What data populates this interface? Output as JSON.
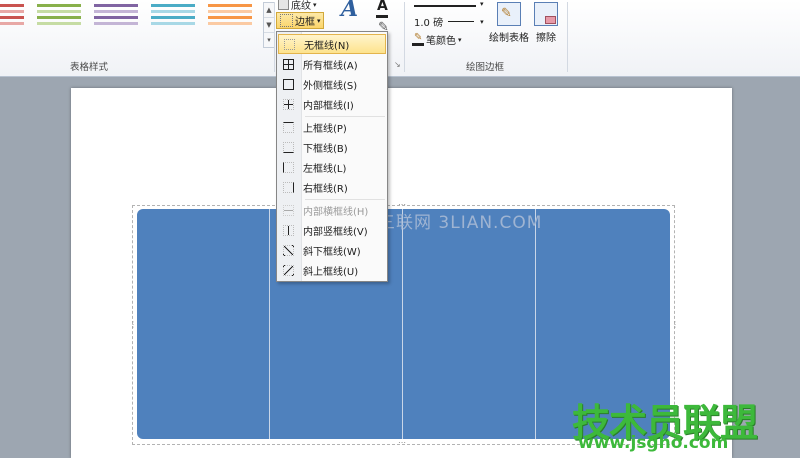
{
  "ribbon": {
    "groups": {
      "table_styles": "表格样式",
      "draw_borders": "绘图边框"
    },
    "shading_label": "底纹",
    "borders_label": "边框",
    "line_weight": "1.0 磅",
    "pen_color_label": "笔颜色",
    "draw_table_label": "绘制表格",
    "eraser_label": "擦除"
  },
  "border_menu": {
    "items": [
      {
        "label": "无框线(N)",
        "icon": "no-border-icon",
        "highlighted": true,
        "disabled": false
      },
      {
        "label": "所有框线(A)",
        "icon": "all-borders-icon",
        "highlighted": false,
        "disabled": false
      },
      {
        "label": "外侧框线(S)",
        "icon": "outside-borders-icon",
        "highlighted": false,
        "disabled": false
      },
      {
        "label": "内部框线(I)",
        "icon": "inside-borders-icon",
        "highlighted": false,
        "disabled": false
      },
      {
        "label": "上框线(P)",
        "icon": "top-border-icon",
        "highlighted": false,
        "disabled": false
      },
      {
        "label": "下框线(B)",
        "icon": "bottom-border-icon",
        "highlighted": false,
        "disabled": false
      },
      {
        "label": "左框线(L)",
        "icon": "left-border-icon",
        "highlighted": false,
        "disabled": false
      },
      {
        "label": "右框线(R)",
        "icon": "right-border-icon",
        "highlighted": false,
        "disabled": false
      },
      {
        "label": "内部横框线(H)",
        "icon": "inside-horizontal-border-icon",
        "highlighted": false,
        "disabled": true
      },
      {
        "label": "内部竖框线(V)",
        "icon": "inside-vertical-border-icon",
        "highlighted": false,
        "disabled": false
      },
      {
        "label": "斜下框线(W)",
        "icon": "diagonal-down-border-icon",
        "highlighted": false,
        "disabled": false
      },
      {
        "label": "斜上框线(U)",
        "icon": "diagonal-up-border-icon",
        "highlighted": false,
        "disabled": false
      }
    ]
  },
  "document": {
    "table_color": "#4f81bd"
  },
  "watermarks": {
    "site_line": "三联网 3LIAN.COM",
    "brand": "技术员联盟",
    "brand_url": "www.jsgho.com"
  }
}
